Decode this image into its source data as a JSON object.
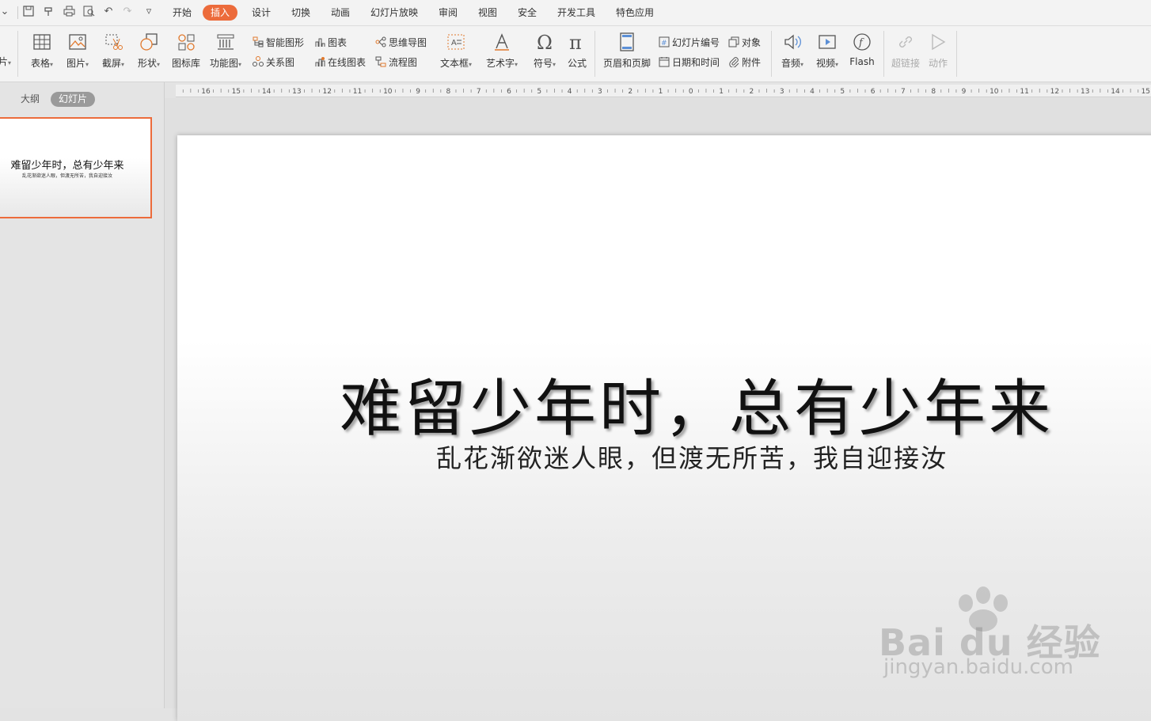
{
  "menu": {
    "tabs": [
      "开始",
      "插入",
      "设计",
      "切换",
      "动画",
      "幻灯片放映",
      "审阅",
      "视图",
      "安全",
      "开发工具",
      "特色应用"
    ],
    "active": "插入"
  },
  "ribbon": {
    "cut_label": "片",
    "table": "表格",
    "picture": "图片",
    "screenshot": "截屏",
    "shape": "形状",
    "icon_lib": "图标库",
    "function_chart": "功能图",
    "smart_art": "智能图形",
    "chart": "图表",
    "relation": "关系图",
    "online_chart": "在线图表",
    "mindmap": "思维导图",
    "flowchart": "流程图",
    "textbox": "文本框",
    "wordart": "艺术字",
    "symbol": "符号",
    "formula": "公式",
    "header_footer": "页眉和页脚",
    "slide_number": "幻灯片编号",
    "object": "对象",
    "date_time": "日期和时间",
    "attachment": "附件",
    "audio": "音频",
    "video": "视频",
    "flash": "Flash",
    "hyperlink": "超链接",
    "action": "动作"
  },
  "left_panel": {
    "outline_tab": "大纲",
    "slides_tab": "幻灯片"
  },
  "slide": {
    "title": "难留少年时，总有少年来",
    "subtitle": "乱花渐欲迷人眼，但渡无所苦，我自迎接汝"
  },
  "ruler": {
    "labels": [
      "16",
      "15",
      "14",
      "13",
      "12",
      "11",
      "10",
      "9",
      "8",
      "7",
      "6",
      "5",
      "4",
      "3",
      "2",
      "1",
      "0",
      "1",
      "2",
      "3",
      "4",
      "5",
      "6",
      "7",
      "8",
      "9",
      "10",
      "11",
      "12",
      "13",
      "14",
      "15"
    ]
  },
  "watermark": {
    "main": "Bai du 经验",
    "url": "jingyan.baidu.com"
  },
  "colors": {
    "accent": "#ec6b3b"
  }
}
